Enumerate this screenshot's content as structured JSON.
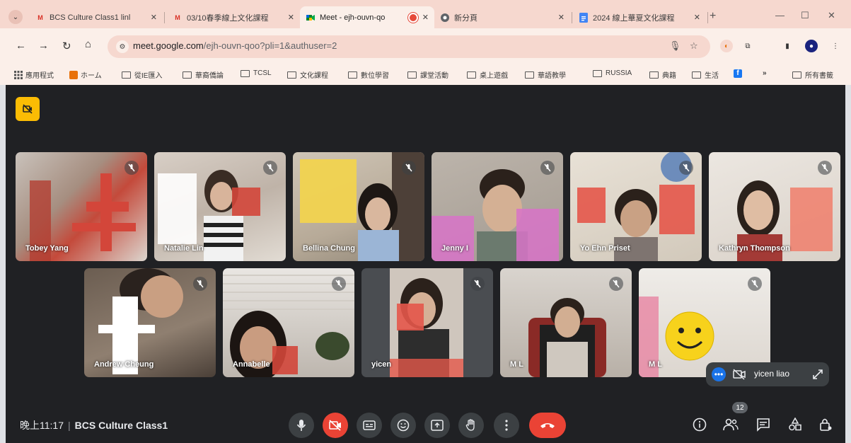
{
  "browser": {
    "tabs": [
      {
        "title": "BCS Culture Class1 linl",
        "favicon": "gmail",
        "active": false
      },
      {
        "title": "03/10春季線上文化課程",
        "favicon": "gmail",
        "active": false
      },
      {
        "title": "Meet - ejh-ouvn-qo",
        "favicon": "meet",
        "active": true
      },
      {
        "title": "新分頁",
        "favicon": "chrome",
        "active": false
      },
      {
        "title": "2024 線上華夏文化課程",
        "favicon": "docs",
        "active": false
      }
    ],
    "url": {
      "host": "meet.google.com",
      "path": "/ejh-ouvn-qoo?pli=1&authuser=2"
    },
    "bookmarks": [
      "應用程式",
      "ホーム",
      "從IE匯入",
      "華裔僑論",
      "TCSL",
      "文化課程",
      "數位學習",
      "課堂活動",
      "桌上遊戲",
      "華語教學",
      "RUSSIA",
      "典籍",
      "生活"
    ],
    "bookmarks_more": "»",
    "all_bookmarks": "所有書籤"
  },
  "meet": {
    "time": "晚上11:17",
    "separator": "|",
    "meeting_name": "BCS Culture Class1",
    "participant_count": "12",
    "participants_row1": [
      "Tobey Yang",
      "Natalie Lin",
      "Bellina Chung",
      "Jenny I",
      "Yo Ehn Priset",
      "Kathryn Thompson"
    ],
    "participants_row2": [
      "Andrew Cheung",
      "Annabelle",
      "yicen",
      "M L",
      "M L"
    ],
    "self_view": {
      "name": "yicen liao"
    },
    "colors": {
      "hangup": "#ea4335",
      "badge": "#fbbc04",
      "bg": "#202124",
      "control": "#3c4043"
    }
  }
}
